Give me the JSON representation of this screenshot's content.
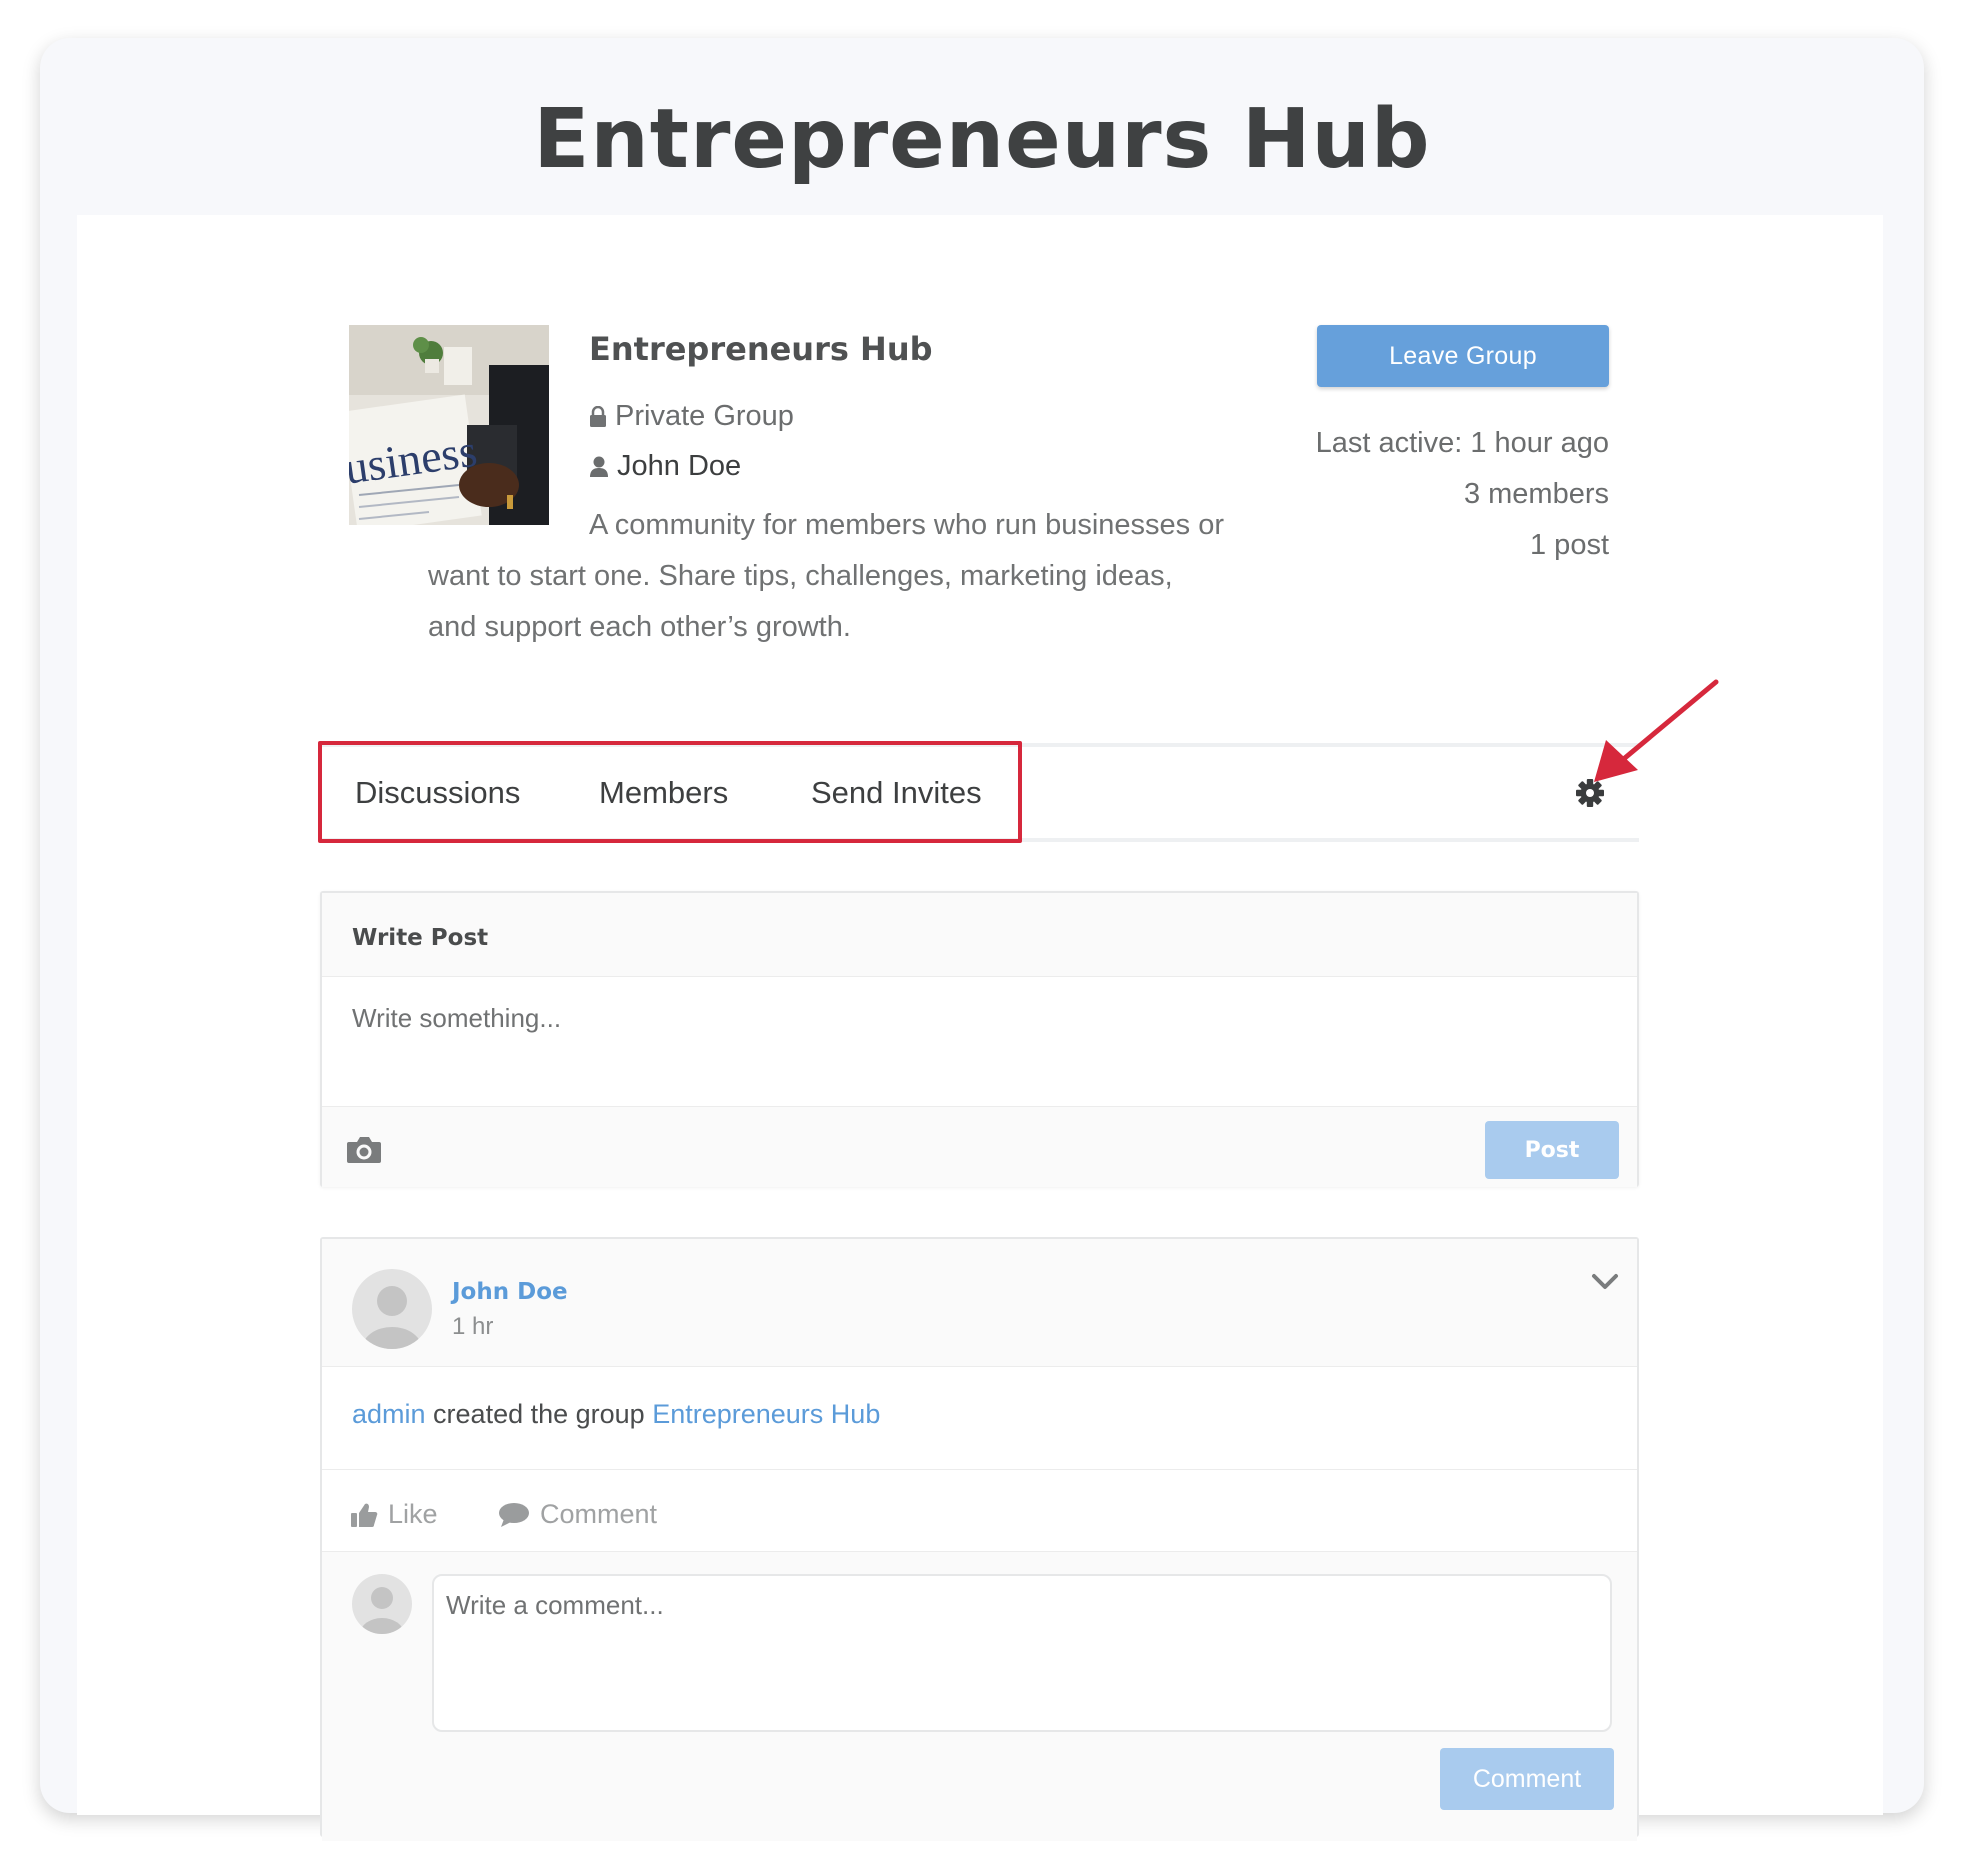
{
  "page": {
    "title": "Entrepreneurs Hub"
  },
  "group": {
    "name": "Entrepreneurs Hub",
    "privacy": "Private Group",
    "owner": "John Doe",
    "description": "A community for members who run businesses or want to start one. Share tips, challenges, marketing ideas, and support each other’s growth.",
    "image_text": "usiness",
    "leave_label": "Leave Group",
    "last_active": "Last active: 1 hour ago",
    "members_count": "3 members",
    "posts_count": "1 post"
  },
  "tabs": [
    {
      "label": "Discussions"
    },
    {
      "label": "Members"
    },
    {
      "label": "Send Invites"
    }
  ],
  "write_post": {
    "title": "Write Post",
    "placeholder": "Write something...",
    "post_label": "Post"
  },
  "activity": {
    "author": "John Doe",
    "time": "1 hr",
    "actor": "admin",
    "action_text": " created the group ",
    "group_link": "Entrepreneurs Hub",
    "like_label": "Like",
    "comment_label": "Comment",
    "comment_placeholder": "Write a comment...",
    "comment_button": "Comment"
  },
  "colors": {
    "accent": "#66a0db",
    "link": "#5b9bd9",
    "highlight": "#d6283c",
    "disabled_button": "#a9cbee"
  },
  "icons": [
    "lock-icon",
    "user-icon",
    "gear-icon",
    "camera-icon",
    "chevron-down-icon",
    "thumbs-up-icon",
    "comment-bubble-icon",
    "avatar-icon",
    "annotation-arrow-icon"
  ]
}
